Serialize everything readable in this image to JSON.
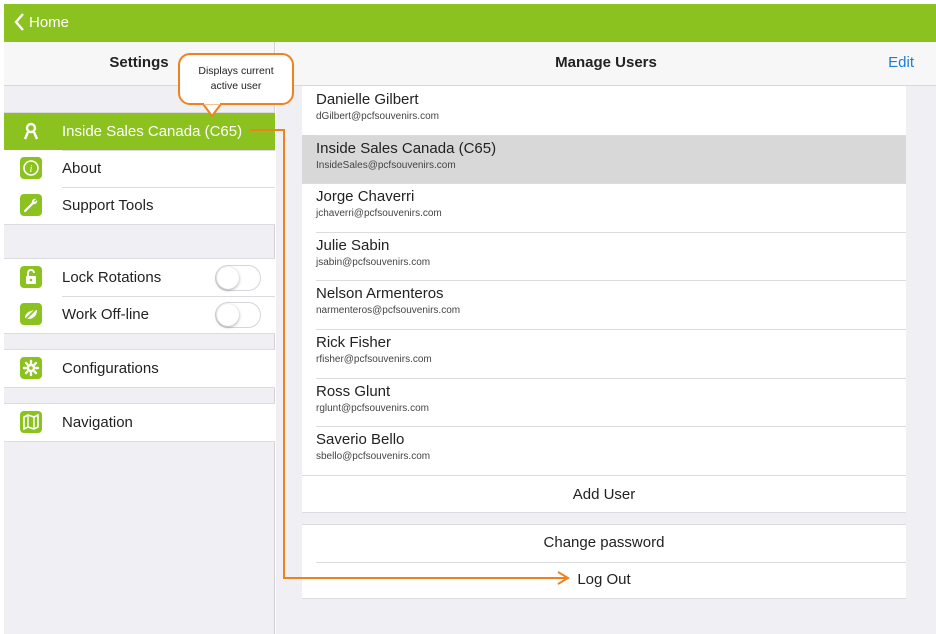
{
  "topbar": {
    "back_label": "Home"
  },
  "sidebar": {
    "title": "Settings",
    "active_user": "Inside Sales Canada (C65)",
    "items": [
      {
        "label": "About",
        "icon": "info-icon"
      },
      {
        "label": "Support Tools",
        "icon": "wrench-icon"
      }
    ],
    "toggles": [
      {
        "label": "Lock Rotations",
        "icon": "lock-rotation-icon",
        "on": false
      },
      {
        "label": "Work Off-line",
        "icon": "offline-icon",
        "on": false
      }
    ],
    "configurations_label": "Configurations",
    "navigation_label": "Navigation"
  },
  "main": {
    "title": "Manage Users",
    "edit_label": "Edit",
    "users": [
      {
        "name": "Danielle Gilbert",
        "email": "dGilbert@pcfsouvenirs.com"
      },
      {
        "name": "Inside Sales Canada (C65)",
        "email": "InsideSales@pcfsouvenirs.com"
      },
      {
        "name": "Jorge Chaverri",
        "email": "jchaverri@pcfsouvenirs.com"
      },
      {
        "name": "Julie Sabin",
        "email": "jsabin@pcfsouvenirs.com"
      },
      {
        "name": "Nelson Armenteros",
        "email": "narmenteros@pcfsouvenirs.com"
      },
      {
        "name": "Rick Fisher",
        "email": "rfisher@pcfsouvenirs.com"
      },
      {
        "name": "Ross Glunt",
        "email": "rglunt@pcfsouvenirs.com"
      },
      {
        "name": "Saverio Bello",
        "email": "sbello@pcfsouvenirs.com"
      }
    ],
    "add_user_label": "Add User",
    "change_password_label": "Change password",
    "logout_label": "Log Out"
  },
  "callout": {
    "line1": "Displays current",
    "line2": "active user"
  },
  "colors": {
    "accent": "#8cc21f",
    "link": "#1a7ed8",
    "callout": "#f0821e"
  }
}
